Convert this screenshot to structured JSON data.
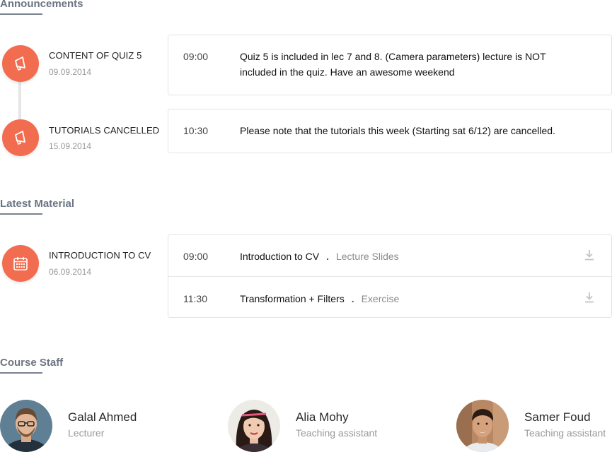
{
  "announcements": {
    "title": "Announcements",
    "items": [
      {
        "title": "CONTENT OF QUIZ 5",
        "date": "09.09.2014",
        "time": "09:00",
        "message": "Quiz 5 is included in lec 7 and 8. (Camera parameters) lecture is NOT included in the quiz. Have an awesome weekend",
        "icon": "megaphone-icon"
      },
      {
        "title": "TUTORIALS CANCELLED",
        "date": "15.09.2014",
        "time": "10:30",
        "message": "Please note that the tutorials this week (Starting sat 6/12) are cancelled.",
        "icon": "megaphone-icon"
      }
    ]
  },
  "latest_material": {
    "title": "Latest Material",
    "item": {
      "title": "INTRODUCTION TO CV",
      "date": "06.09.2014",
      "icon": "calendar-icon"
    },
    "rows": [
      {
        "time": "09:00",
        "title": "Introduction to CV",
        "separator": ".",
        "type": "Lecture Slides",
        "icon": "download-icon"
      },
      {
        "time": "11:30",
        "title": "Transformation + Filters",
        "separator": ".",
        "type": "Exercise",
        "icon": "download-icon"
      }
    ]
  },
  "course_staff": {
    "title": "Course Staff",
    "members": [
      {
        "name": "Galal Ahmed",
        "role": "Lecturer"
      },
      {
        "name": "Alia Mohy",
        "role": "Teaching assistant"
      },
      {
        "name": "Samer Foud",
        "role": "Teaching assistant"
      }
    ]
  },
  "colors": {
    "accent": "#f26d4f",
    "heading": "#6b7482",
    "muted": "#9a9a9a",
    "border": "#e3e3e3"
  }
}
